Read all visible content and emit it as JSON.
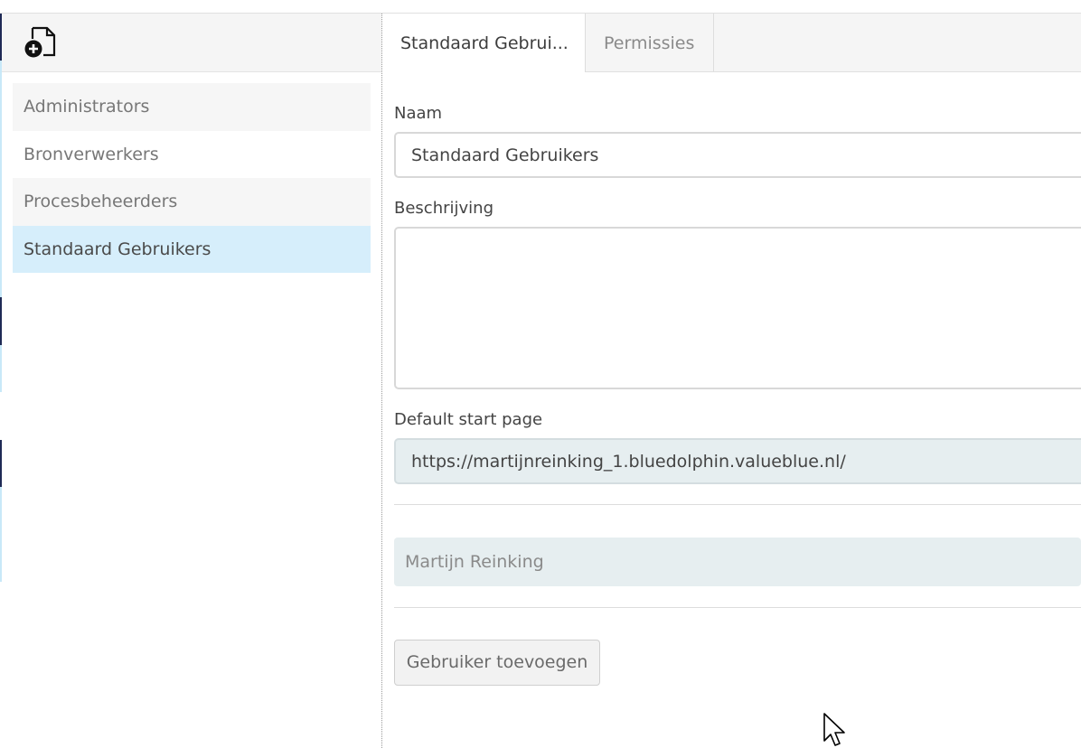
{
  "sidebar": {
    "new_button_icon": "new-document-plus-icon",
    "groups": [
      {
        "label": "Administrators"
      },
      {
        "label": "Bronverwerkers"
      },
      {
        "label": "Procesbeheerders"
      },
      {
        "label": "Standaard Gebruikers",
        "selected": true
      }
    ]
  },
  "tabs": [
    {
      "label": "Standaard Gebrui...",
      "active": true
    },
    {
      "label": "Permissies",
      "active": false
    }
  ],
  "form": {
    "name_label": "Naam",
    "name_value": "Standaard Gebruikers",
    "description_label": "Beschrijving",
    "description_value": "",
    "start_page_label": "Default start page",
    "start_page_value": "https://martijnreinking_1.bluedolphin.valueblue.nl/"
  },
  "members": [
    {
      "name": "Martijn Reinking"
    }
  ],
  "add_user_label": "Gebruiker toevoegen",
  "colors": {
    "selected_row": "#d6eefb",
    "readonly_field": "#e6eef0",
    "edge_dark": "#1f2a55",
    "edge_light": "#c8e8f8"
  }
}
